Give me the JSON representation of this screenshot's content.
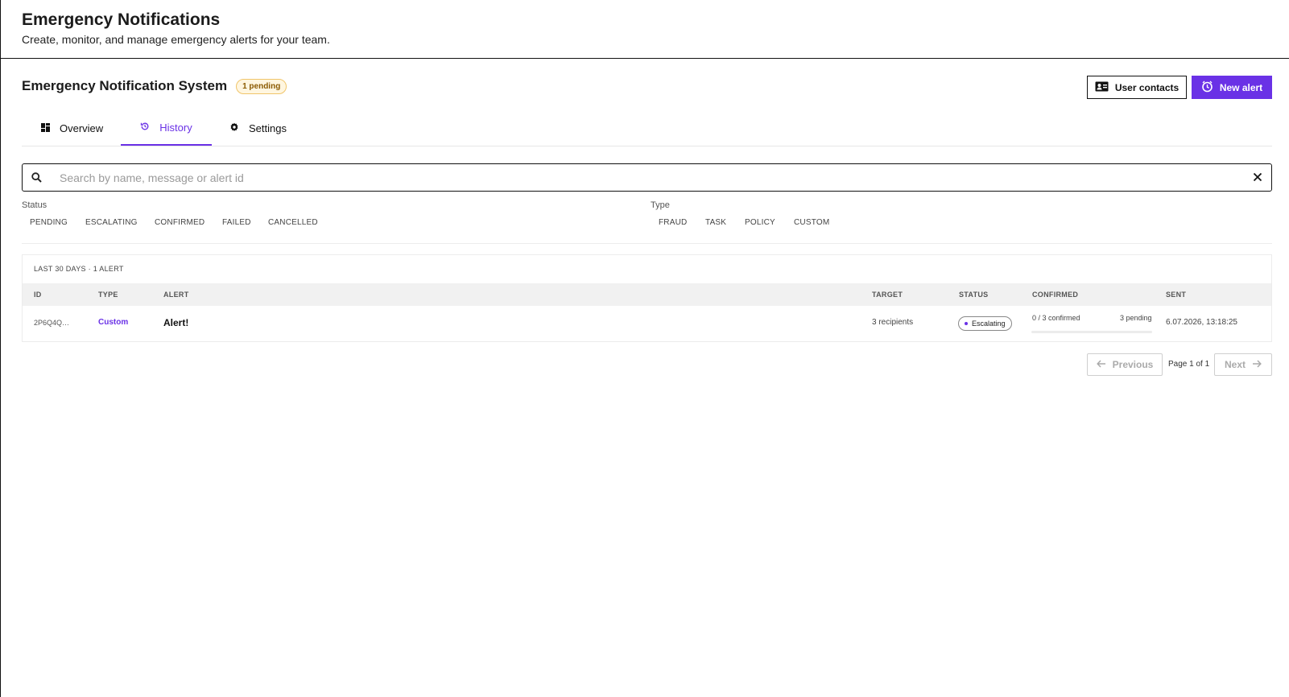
{
  "header": {
    "title": "Emergency Notifications",
    "subtitle": "Create, monitor, and manage emergency alerts for your team."
  },
  "system": {
    "title": "Emergency Notification System",
    "pending_badge": "1 pending"
  },
  "actions": {
    "contacts_label": "User contacts",
    "new_alert_label": "New alert"
  },
  "tabs": [
    {
      "label": "Overview",
      "icon": "dashboard-icon",
      "active": false
    },
    {
      "label": "History",
      "icon": "history-icon",
      "active": true
    },
    {
      "label": "Settings",
      "icon": "gear-icon",
      "active": false
    }
  ],
  "search": {
    "placeholder": "Search by name, message or alert id",
    "value": ""
  },
  "filters": {
    "status_label": "Status",
    "status_options": [
      "PENDING",
      "ESCALATING",
      "CONFIRMED",
      "FAILED",
      "CANCELLED"
    ],
    "type_label": "Type",
    "type_options": [
      "FRAUD",
      "TASK",
      "POLICY",
      "CUSTOM"
    ]
  },
  "table": {
    "summary": "LAST 30 DAYS · 1 ALERT",
    "columns": [
      "ID",
      "TYPE",
      "ALERT",
      "TARGET",
      "STATUS",
      "CONFIRMED",
      "SENT"
    ],
    "rows": [
      {
        "id": "2P6Q4Q…",
        "type": "Custom",
        "alert": "Alert!",
        "target": "3 recipients",
        "status": "Escalating",
        "confirmed_text": "0 / 3 confirmed",
        "pending_text": "3 pending",
        "confirmed_fraction": 0,
        "sent": "6.07.2026, 13:18:25"
      }
    ]
  },
  "pagination": {
    "previous_label": "Previous",
    "next_label": "Next",
    "page_info": "Page 1 of 1"
  },
  "colors": {
    "accent": "#6a31e6",
    "pending_badge_bg": "#fff6e0",
    "pending_badge_border": "#f0c56a"
  }
}
